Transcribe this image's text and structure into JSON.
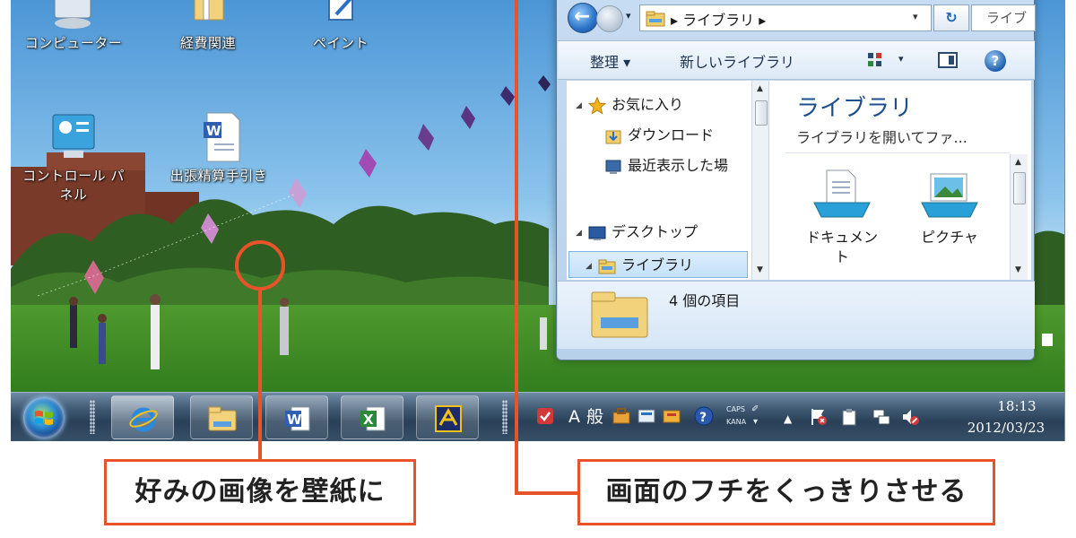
{
  "desktop": {
    "icons": [
      {
        "label": "コンピューター",
        "icon": "computer-icon"
      },
      {
        "label": "経費関連",
        "icon": "folder-icon"
      },
      {
        "label": "ペイント",
        "icon": "paint-icon"
      },
      {
        "label_line1": "コントロール パ",
        "label_line2": "ネル",
        "icon": "control-panel-icon"
      },
      {
        "label": "出張精算手引き",
        "icon": "word-document-icon"
      }
    ]
  },
  "explorer": {
    "address": "▸ ライブラリ ▸",
    "search_placeholder": "ライブ",
    "commands": {
      "organize": "整理 ▾",
      "new_library": "新しいライブラリ"
    },
    "nav": {
      "favorites": "お気に入り",
      "downloads": "ダウンロード",
      "recent": "最近表示した場",
      "desktop": "デスクトップ",
      "library": "ライブラリ"
    },
    "content": {
      "title": "ライブラリ",
      "description": "ライブラリを開いてファ...",
      "tiles": [
        {
          "label_line1": "ドキュメン",
          "label_line2": "ト"
        },
        {
          "label_line1": "ピクチャ",
          "label_line2": ""
        }
      ]
    },
    "details": {
      "item_count": "4 個の項目"
    }
  },
  "taskbar": {
    "pinned": [
      "internet-explorer-icon",
      "explorer-folder-icon",
      "word-icon",
      "excel-icon",
      "app-icon"
    ],
    "tray": {
      "ime_mode": "A",
      "ime_kanji": "般",
      "caps": "CAPS",
      "kana": "KANA",
      "expand": "▲",
      "time": "18:13",
      "date": "2012/03/23"
    }
  },
  "annotations": {
    "left_caption": "好みの画像を壁紙に",
    "right_caption": "画面のフチをくっきりさせる"
  },
  "colors": {
    "accent": "#e8532a",
    "library_title": "#1e4f8c",
    "taskbar": "#2a4058"
  }
}
